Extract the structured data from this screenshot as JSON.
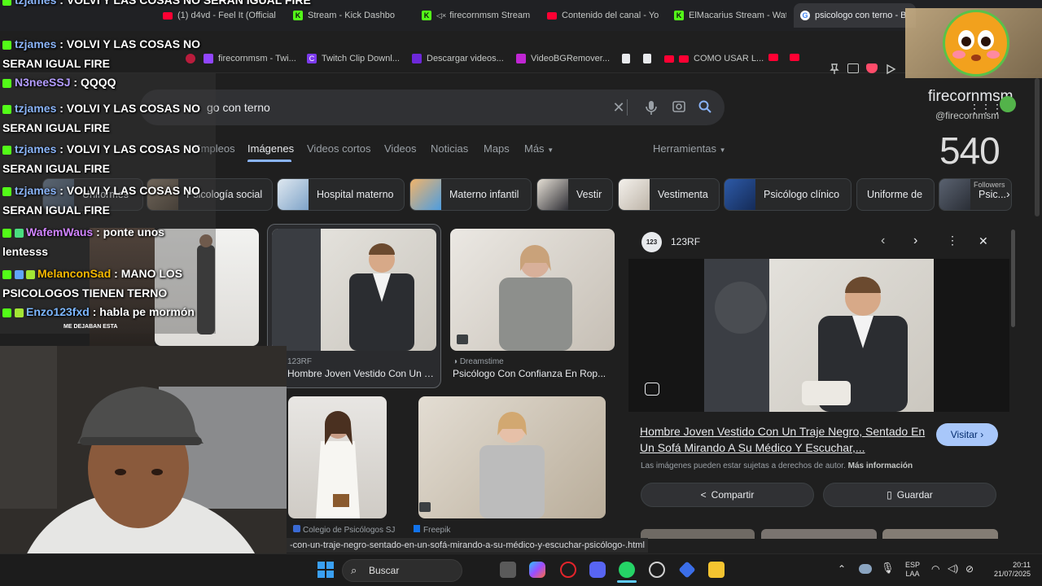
{
  "browser": {
    "tabs": [
      {
        "label": "(1) d4vd - Feel It (Official",
        "icon": "youtube-icon",
        "color": "#ff0033"
      },
      {
        "label": "Stream - Kick Dashbo",
        "icon": "kick-icon",
        "color": "#53fc18"
      },
      {
        "label": "firecornmsm Stream",
        "icon": "muted-icon",
        "color": "#53fc18"
      },
      {
        "label": "Contenido del canal - Yo",
        "icon": "youtube-icon",
        "color": "#ff0033"
      },
      {
        "label": "ElMacarius Stream - Wat",
        "icon": "kick-icon",
        "color": "#53fc18"
      },
      {
        "label": "psicologo con terno - B",
        "icon": "google-icon",
        "color": "#4285f4",
        "active": true
      }
    ],
    "bookmarks": [
      {
        "label": "firecornmsm - Twi...",
        "color": "#9146ff"
      },
      {
        "label": "Twitch Clip Downl...",
        "color": "#7c3aed"
      },
      {
        "label": "Descargar videos...",
        "color": "#6d28d9"
      },
      {
        "label": "VideoBGRemover...",
        "color": "#c026d3"
      },
      {
        "label": "COMO USAR L...",
        "color": "#ff0033"
      }
    ]
  },
  "search": {
    "query": "psicologo con terno",
    "visible_query": "go con terno"
  },
  "nav_tabs": [
    {
      "label": "Empleos"
    },
    {
      "label": "Imágenes",
      "active": true
    },
    {
      "label": "Videos cortos"
    },
    {
      "label": "Videos"
    },
    {
      "label": "Noticias"
    },
    {
      "label": "Maps"
    },
    {
      "label": "Más"
    }
  ],
  "tools_label": "Herramientas",
  "chips": [
    {
      "label": "Uniformes"
    },
    {
      "label": "Psicología social"
    },
    {
      "label": "Hospital materno"
    },
    {
      "label": "Materno infantil"
    },
    {
      "label": "Vestir"
    },
    {
      "label": "Vestimenta"
    },
    {
      "label": "Psicólogo clínico"
    },
    {
      "label": "Uniforme de"
    },
    {
      "label": "Psic..."
    }
  ],
  "results": [
    {
      "source": "123RF",
      "title": "Hombre Joven Vestido Con Un Tr..."
    },
    {
      "source": "Dreamstime",
      "title": "Psicólogo Con Confianza En Rop..."
    },
    {
      "source": "Colegio de Psicólogos SJ",
      "title": ""
    },
    {
      "source": "Freepik",
      "title": ""
    }
  ],
  "panel": {
    "source": "123RF",
    "title": "Hombre Joven Vestido Con Un Traje Negro, Sentado En Un Sofá Mirando A Su Médico Y Escuchar,...",
    "visit_label": "Visitar",
    "copyright": "Las imágenes pueden estar sujetas a derechos de autor.",
    "more_info": "Más información",
    "share_label": "Compartir",
    "save_label": "Guardar"
  },
  "status_url": "-con-un-traje-negro-sentado-en-un-sofá-mirando-a-su-médico-y-escuchar-psicólogo-.html",
  "chat": [
    {
      "user": "tzjames",
      "color": "#8ab4f8",
      "text": "VOLVI Y LAS COSAS NO SERAN IGUAL FIRE"
    },
    {
      "user": "tzjames",
      "color": "#8ab4f8",
      "text": "VOLVI Y LAS COSAS NO SERAN IGUAL FIRE"
    },
    {
      "user": "N3neeSSJ",
      "color": "#b39cff",
      "text": "QQQQ"
    },
    {
      "user": "tzjames",
      "color": "#8ab4f8",
      "text": "VOLVI Y LAS COSAS NO SERAN IGUAL FIRE"
    },
    {
      "user": "tzjames",
      "color": "#8ab4f8",
      "text": "VOLVI Y LAS COSAS NO SERAN IGUAL FIRE"
    },
    {
      "user": "tzjames",
      "color": "#8ab4f8",
      "text": "VOLVI Y LAS COSAS NO SERAN IGUAL FIRE"
    },
    {
      "user": "WafemWaus",
      "color": "#d084ff",
      "text": "ponte unos lentesss"
    },
    {
      "user": "MelanconSad",
      "color": "#f5b800",
      "text": "MANO LOS PSICOLOGOS TIENEN TERNO"
    },
    {
      "user": "Enzo123fxd",
      "color": "#7cb7ff",
      "text": "habla pe mormón"
    }
  ],
  "stream_overlay": {
    "name": "firecornmsm",
    "handle": "@firecornmsm",
    "follower_count": "540",
    "followers_label": "Followers",
    "cam_caption": "ME DEJABAN ESTA"
  },
  "taskbar": {
    "search_label": "Buscar",
    "language": "ESP",
    "layout": "LAA",
    "time": "20:11",
    "date": "21/07/2025"
  }
}
